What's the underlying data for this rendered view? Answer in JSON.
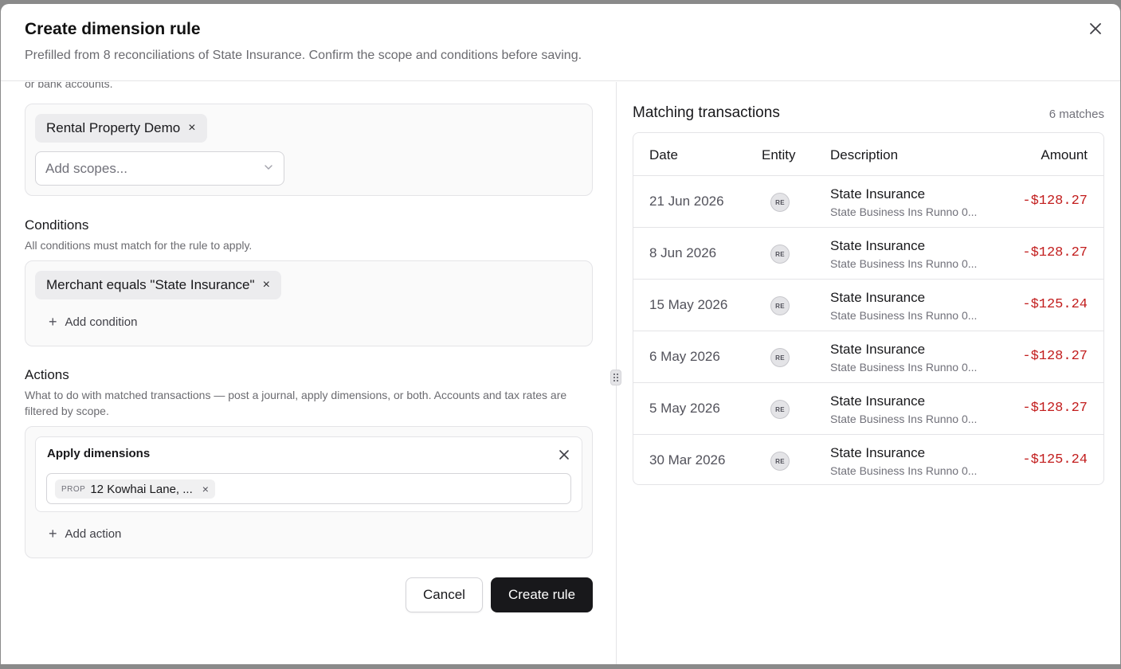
{
  "dialog": {
    "title": "Create dimension rule",
    "subtitle": "Prefilled from 8 reconciliations of State Insurance. Confirm the scope and conditions before saving."
  },
  "scope": {
    "cut_text": "or bank accounts.",
    "chips": [
      {
        "label": "Rental Property Demo",
        "remove": "×"
      }
    ],
    "placeholder": "Add scopes..."
  },
  "conditions": {
    "title": "Conditions",
    "subtitle": "All conditions must match for the rule to apply.",
    "chips": [
      {
        "label": "Merchant equals \"State Insurance\"",
        "remove": "×"
      }
    ],
    "add_label": "Add condition"
  },
  "actions": {
    "title": "Actions",
    "subtitle": "What to do with matched transactions — post a journal, apply dimensions, or both. Accounts and tax rates are filtered by scope.",
    "card": {
      "title": "Apply dimensions",
      "chip": {
        "tag": "PROP",
        "label": "12 Kowhai Lane, ...",
        "remove": "×"
      }
    },
    "add_label": "Add action"
  },
  "footer": {
    "cancel_label": "Cancel",
    "create_label": "Create rule"
  },
  "matches": {
    "title": "Matching transactions",
    "count": "6 matches",
    "columns": {
      "date": "Date",
      "entity": "Entity",
      "description": "Description",
      "amount": "Amount"
    },
    "rows": [
      {
        "date": "21 Jun 2026",
        "entity": "RE",
        "desc": "State Insurance",
        "sub": "State Business Ins Runno 0...",
        "amount": "-$128.27"
      },
      {
        "date": "8 Jun 2026",
        "entity": "RE",
        "desc": "State Insurance",
        "sub": "State Business Ins Runno 0...",
        "amount": "-$128.27"
      },
      {
        "date": "15 May 2026",
        "entity": "RE",
        "desc": "State Insurance",
        "sub": "State Business Ins Runno 0...",
        "amount": "-$125.24"
      },
      {
        "date": "6 May 2026",
        "entity": "RE",
        "desc": "State Insurance",
        "sub": "State Business Ins Runno 0...",
        "amount": "-$128.27"
      },
      {
        "date": "5 May 2026",
        "entity": "RE",
        "desc": "State Insurance",
        "sub": "State Business Ins Runno 0...",
        "amount": "-$128.27"
      },
      {
        "date": "30 Mar 2026",
        "entity": "RE",
        "desc": "State Insurance",
        "sub": "State Business Ins Runno 0...",
        "amount": "-$125.24"
      }
    ]
  },
  "colors": {
    "accent": "#18181b",
    "negative": "#c21d1d"
  }
}
